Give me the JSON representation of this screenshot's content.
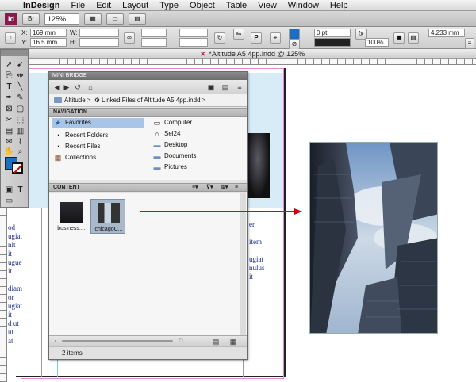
{
  "menubar": {
    "apple": "",
    "app": "InDesign",
    "items": [
      "File",
      "Edit",
      "Layout",
      "Type",
      "Object",
      "Table",
      "View",
      "Window",
      "Help"
    ]
  },
  "appbar": {
    "logo": "Id",
    "zoom": "125%"
  },
  "control": {
    "x_label": "X:",
    "x_value": "169 mm",
    "y_label": "Y:",
    "y_value": "16.5 mm",
    "w_label": "W:",
    "h_label": "H:",
    "stroke_weight": "0 pt",
    "opacity": "100%",
    "spacing": "4.233 mm"
  },
  "document": {
    "tab_title": "*Altitude A5 4pp.indd @ 125%",
    "close_glyph": "✕",
    "body_text": [
      "od",
      "",
      "ugiat",
      "nit",
      "it",
      "ugue",
      "it",
      "",
      "diam",
      "or",
      "ugiat",
      "it",
      "d ut",
      "ut",
      "at"
    ],
    "right_text": [
      "er",
      "",
      "item",
      "",
      "ugiat",
      "nulus",
      "it",
      "",
      "",
      "",
      "",
      "",
      "",
      "",
      ""
    ]
  },
  "mini_bridge": {
    "title": "MINI BRIDGE",
    "path_root": "Altitude",
    "path_sep": ">",
    "path_child": "Linked Files of Altitude A5 4pp.indd",
    "navigation_header": "NAVIGATION",
    "favorites": [
      {
        "label": "Favorites",
        "icon": "star-icon"
      },
      {
        "label": "Recent Folders",
        "icon": "recent-folders-icon"
      },
      {
        "label": "Recent Files",
        "icon": "recent-files-icon"
      },
      {
        "label": "Collections",
        "icon": "collections-icon"
      }
    ],
    "places": [
      {
        "label": "Computer",
        "icon": "computer-icon"
      },
      {
        "label": "Sel24",
        "icon": "user-icon"
      },
      {
        "label": "Desktop",
        "icon": "folder-icon"
      },
      {
        "label": "Documents",
        "icon": "folder-icon"
      },
      {
        "label": "Pictures",
        "icon": "folder-icon"
      }
    ],
    "content_header": "CONTENT",
    "thumbnails": [
      {
        "label": "business....",
        "selected": false
      },
      {
        "label": "chicagoC...",
        "selected": true
      }
    ],
    "status": "2 items"
  },
  "colors": {
    "accent_red": "#e00000",
    "indesign_brand": "#8a1a4d",
    "selection": "#a8c4e6"
  }
}
